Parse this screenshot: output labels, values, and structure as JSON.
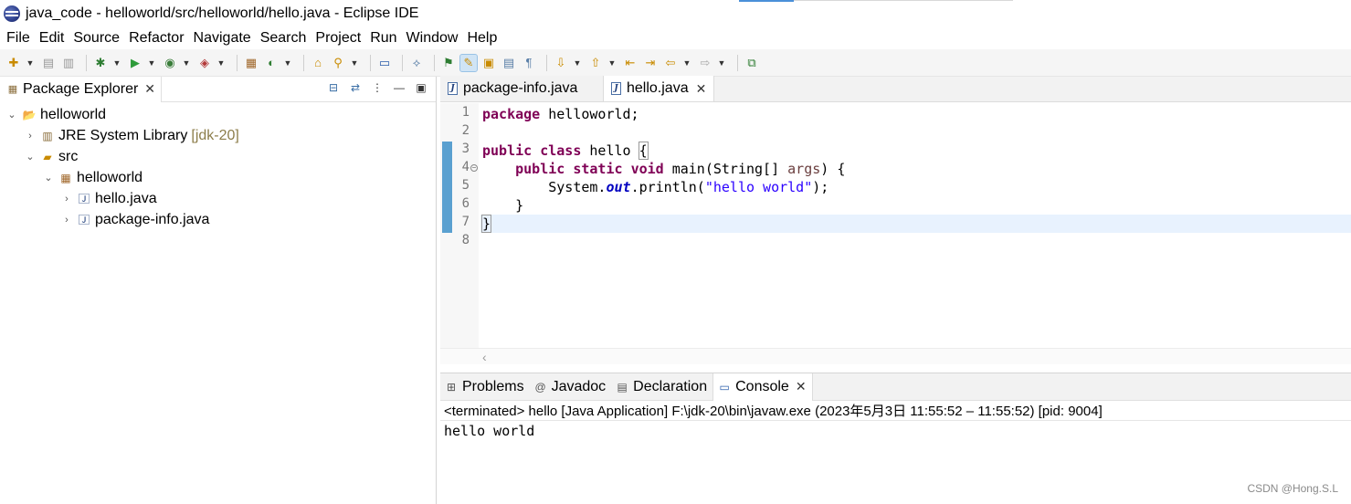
{
  "window": {
    "title": "java_code - helloworld/src/helloworld/hello.java - Eclipse IDE"
  },
  "menubar": {
    "items": [
      "File",
      "Edit",
      "Source",
      "Refactor",
      "Navigate",
      "Search",
      "Project",
      "Run",
      "Window",
      "Help"
    ]
  },
  "toolbar": {
    "buttons": [
      {
        "name": "new-icon",
        "glyph": "✚"
      },
      {
        "name": "save-icon",
        "glyph": "▤"
      },
      {
        "name": "save-all-icon",
        "glyph": "▥"
      },
      {
        "name": "debug-icon",
        "glyph": "✱"
      },
      {
        "name": "run-icon",
        "glyph": "▶"
      },
      {
        "name": "coverage-icon",
        "glyph": "◉"
      },
      {
        "name": "external-tools-icon",
        "glyph": "◈"
      },
      {
        "name": "new-java-package-icon",
        "glyph": "▦"
      },
      {
        "name": "new-java-class-icon",
        "glyph": "◐"
      },
      {
        "name": "open-type-icon",
        "glyph": "⌂"
      },
      {
        "name": "search-icon",
        "glyph": "⚲"
      },
      {
        "name": "terminal-icon",
        "glyph": "▭"
      },
      {
        "name": "pin-icon",
        "glyph": "⟡"
      },
      {
        "name": "annotation-icon",
        "glyph": "⚑"
      },
      {
        "name": "highlight-icon",
        "glyph": "✎"
      },
      {
        "name": "block-select-icon",
        "glyph": "▣"
      },
      {
        "name": "word-wrap-icon",
        "glyph": "▤"
      },
      {
        "name": "show-whitespace-icon",
        "glyph": "¶"
      },
      {
        "name": "next-annotation-icon",
        "glyph": "⇩"
      },
      {
        "name": "prev-annotation-icon",
        "glyph": "⇧"
      },
      {
        "name": "last-edit-icon",
        "glyph": "⇤"
      },
      {
        "name": "forward-edit-icon",
        "glyph": "⇥"
      },
      {
        "name": "back-icon",
        "glyph": "⇦"
      },
      {
        "name": "forward-icon",
        "glyph": "⇨"
      },
      {
        "name": "open-perspective-icon",
        "glyph": "⧉"
      }
    ]
  },
  "package_explorer": {
    "tab_label": "Package Explorer",
    "tree": [
      {
        "label": "helloworld",
        "decoration": "",
        "expanded": true
      },
      {
        "label": "JRE System Library",
        "decoration": "[jdk-20]",
        "expanded": false
      },
      {
        "label": "src",
        "decoration": "",
        "expanded": true
      },
      {
        "label": "helloworld",
        "decoration": "",
        "expanded": true
      },
      {
        "label": "hello.java",
        "decoration": "",
        "expanded": false
      },
      {
        "label": "package-info.java",
        "decoration": "",
        "expanded": false
      }
    ]
  },
  "editor": {
    "tabs": [
      {
        "label": "package-info.java",
        "active": false
      },
      {
        "label": "hello.java",
        "active": true
      }
    ],
    "line_numbers": [
      "1",
      "2",
      "3",
      "4",
      "5",
      "6",
      "7",
      "8"
    ],
    "lines": [
      [
        {
          "t": "package",
          "c": "kw"
        },
        {
          "t": " helloworld;",
          "c": ""
        }
      ],
      [],
      [
        {
          "t": "public",
          "c": "kw"
        },
        {
          "t": " ",
          "c": ""
        },
        {
          "t": "class",
          "c": "kw"
        },
        {
          "t": " hello ",
          "c": ""
        },
        {
          "t": "{",
          "c": "brace-box"
        }
      ],
      [
        {
          "t": "    ",
          "c": ""
        },
        {
          "t": "public",
          "c": "kw"
        },
        {
          "t": " ",
          "c": ""
        },
        {
          "t": "static",
          "c": "kw"
        },
        {
          "t": " ",
          "c": ""
        },
        {
          "t": "void",
          "c": "kw"
        },
        {
          "t": " main(String[] ",
          "c": ""
        },
        {
          "t": "args",
          "c": "param"
        },
        {
          "t": ") {",
          "c": ""
        }
      ],
      [
        {
          "t": "        System.",
          "c": ""
        },
        {
          "t": "out",
          "c": "field"
        },
        {
          "t": ".println(",
          "c": ""
        },
        {
          "t": "\"hello world\"",
          "c": "str"
        },
        {
          "t": ");",
          "c": ""
        }
      ],
      [
        {
          "t": "    }",
          "c": ""
        }
      ],
      [
        {
          "t": "}",
          "c": "brace-box"
        }
      ],
      []
    ],
    "current_line": 7
  },
  "console": {
    "tabs": [
      {
        "label": "Problems",
        "icon": "problems-icon",
        "active": false
      },
      {
        "label": "Javadoc",
        "icon": "javadoc-icon",
        "active": false
      },
      {
        "label": "Declaration",
        "icon": "declaration-icon",
        "active": false
      },
      {
        "label": "Console",
        "icon": "console-icon",
        "active": true
      }
    ],
    "status": "<terminated> hello [Java Application] F:\\jdk-20\\bin\\javaw.exe  (2023年5月3日 11:55:52 – 11:55:52) [pid: 9004]",
    "output": "hello world"
  },
  "watermark": "CSDN @Hong.S.L",
  "colors": {
    "keyword": "#7f0055",
    "string": "#2a00ff",
    "field": "#0000c0",
    "current_line": "#e8f2fe",
    "ruler_mark": "#5aa0d0"
  }
}
